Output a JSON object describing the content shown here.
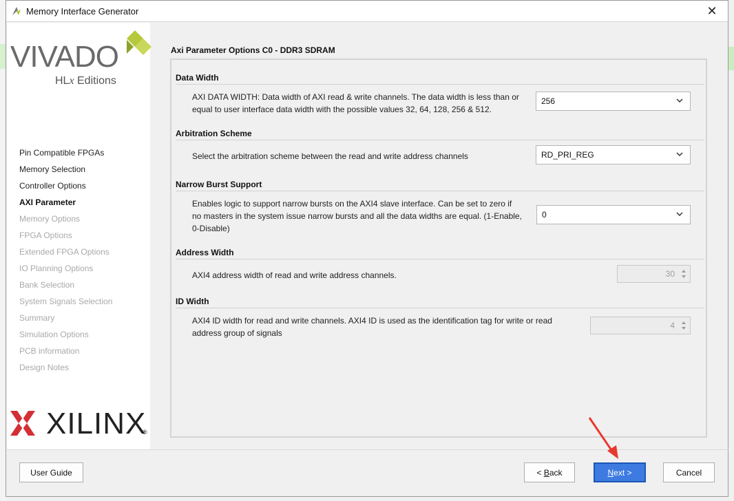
{
  "window": {
    "title": "Memory Interface Generator",
    "close_icon": "close-icon"
  },
  "branding": {
    "vivado": "VIVADO",
    "hlx_prefix": "HL",
    "hlx_x": "x",
    "hlx_suffix": " Editions",
    "xilinx": "XILINX",
    "registered": "®"
  },
  "nav": {
    "items": [
      {
        "label": "Pin Compatible FPGAs",
        "state": "done"
      },
      {
        "label": "Memory Selection",
        "state": "done"
      },
      {
        "label": "Controller Options",
        "state": "done"
      },
      {
        "label": "AXI Parameter",
        "state": "active"
      },
      {
        "label": "Memory Options",
        "state": "pending"
      },
      {
        "label": "FPGA Options",
        "state": "pending"
      },
      {
        "label": "Extended FPGA Options",
        "state": "pending"
      },
      {
        "label": "IO Planning Options",
        "state": "pending"
      },
      {
        "label": "Bank Selection",
        "state": "pending"
      },
      {
        "label": "System Signals Selection",
        "state": "pending"
      },
      {
        "label": "Summary",
        "state": "pending"
      },
      {
        "label": "Simulation Options",
        "state": "pending"
      },
      {
        "label": "PCB information",
        "state": "pending"
      },
      {
        "label": "Design Notes",
        "state": "pending"
      }
    ]
  },
  "main": {
    "header": "Axi Parameter Options C0 - DDR3 SDRAM",
    "sections": {
      "data_width": {
        "title": "Data Width",
        "desc": "AXI DATA WIDTH: Data width of AXI read & write channels. The data width is less than or equal to user interface data width with the possible values 32, 64, 128, 256 & 512.",
        "value": "256"
      },
      "arbitration": {
        "title": "Arbitration Scheme",
        "desc": "Select the arbitration scheme between the read and write address channels",
        "value": "RD_PRI_REG"
      },
      "narrow_burst": {
        "title": "Narrow Burst Support",
        "desc": "Enables logic to support narrow bursts on the AXI4 slave interface. Can be set to zero if no masters in the system issue narrow bursts and all the data widths are equal. (1-Enable, 0-Disable)",
        "value": "0"
      },
      "address_width": {
        "title": "Address Width",
        "desc": "AXI4 address width of read and write address channels.",
        "value": "30"
      },
      "id_width": {
        "title": "ID Width",
        "desc": "AXI4 ID width for read and write channels. AXI4 ID is used as the identification tag for write or read address group of signals",
        "value": "4"
      }
    }
  },
  "buttons": {
    "user_guide": "User Guide",
    "back_prefix": "< ",
    "back_mnemonic": "B",
    "back_rest": "ack",
    "next_mnemonic": "N",
    "next_rest": "ext >",
    "cancel": "Cancel"
  },
  "colors": {
    "primary_button": "#3d7be0",
    "annotation_arrow": "#e8392e",
    "xilinx_red": "#d32f35",
    "vivado_green": "#b6c93c"
  }
}
